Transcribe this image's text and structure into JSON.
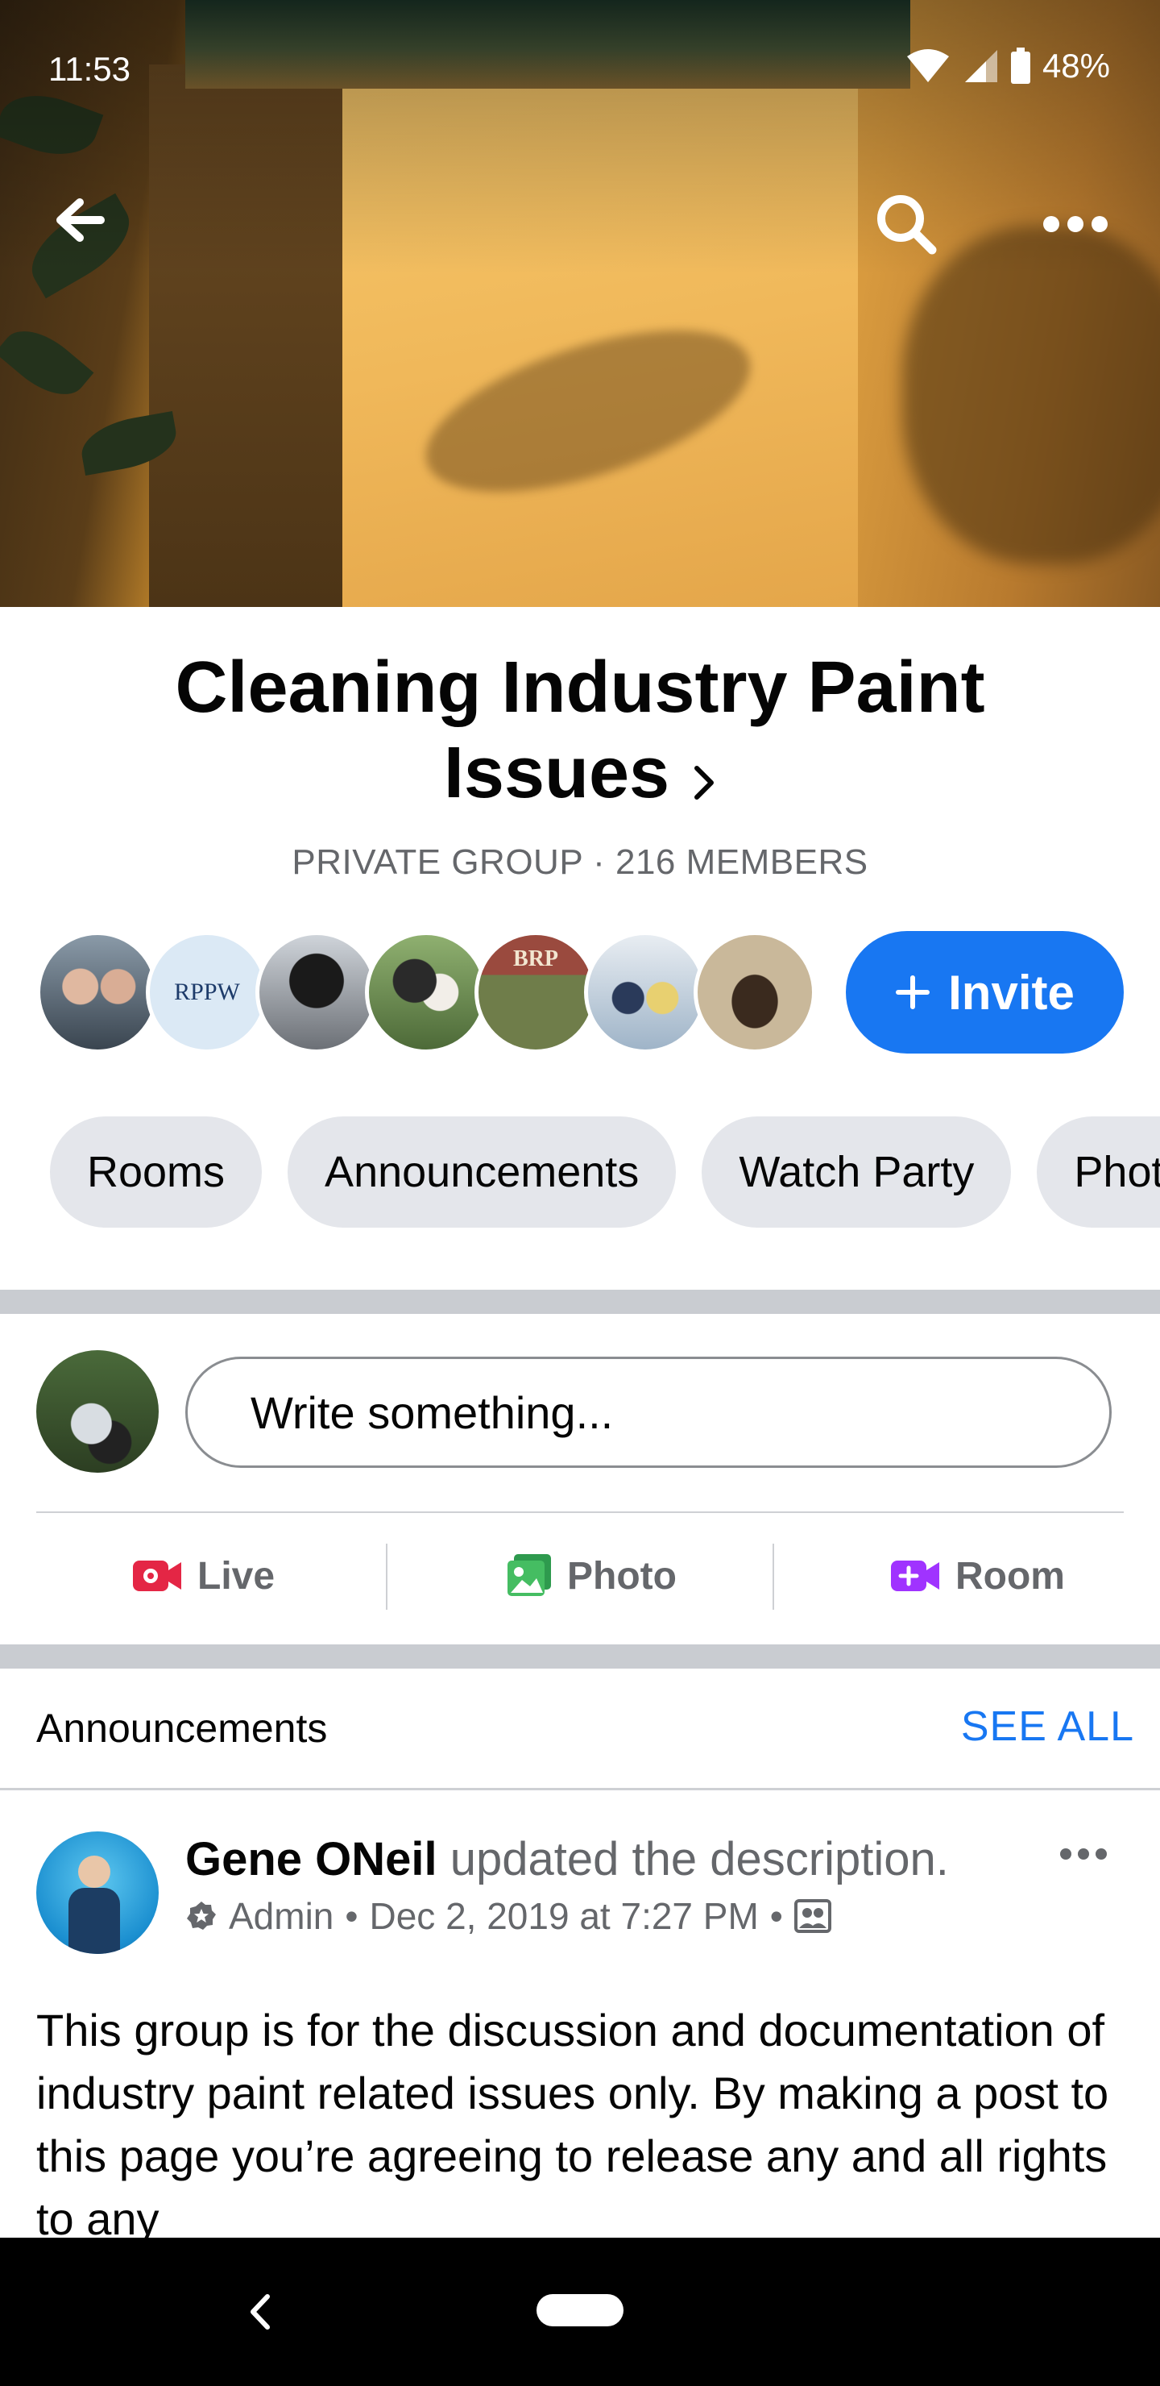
{
  "status_bar": {
    "time": "11:53",
    "battery": "48%"
  },
  "top_actions": {
    "back_icon": "back-arrow-icon",
    "search_icon": "search-icon",
    "more_icon": "more-horizontal-icon"
  },
  "group": {
    "title": "Cleaning Industry Paint Issues",
    "meta": "PRIVATE GROUP · 216 MEMBERS",
    "member_avatars": [
      {
        "name": "member-avatar-1",
        "color": "#5a6a78"
      },
      {
        "name": "member-avatar-2",
        "label": "RPPW",
        "color": "#dbe9f5"
      },
      {
        "name": "member-avatar-3",
        "color": "#3a3a3e"
      },
      {
        "name": "member-avatar-4",
        "color": "#6b8a55"
      },
      {
        "name": "member-avatar-5",
        "label": "BRP",
        "color": "#8c3a32"
      },
      {
        "name": "member-avatar-6",
        "color": "#9fb4c8"
      },
      {
        "name": "member-avatar-7",
        "color": "#c9b89a"
      }
    ],
    "invite_label": "Invite"
  },
  "chips": [
    "Rooms",
    "Announcements",
    "Watch Party",
    "Photos"
  ],
  "composer": {
    "placeholder": "Write something...",
    "live_label": "Live",
    "photo_label": "Photo",
    "room_label": "Room",
    "live_color": "#e42645",
    "photo_color": "#45bd62",
    "room_color": "#a033ff"
  },
  "announcements": {
    "header": "Announcements",
    "see_all": "SEE ALL",
    "post": {
      "author": "Gene ONeil",
      "action": "updated the description.",
      "role": "Admin",
      "date": "Dec 2, 2019 at 7:27 PM",
      "body": "This group is for the discussion and documentation of industry paint related issues only.  By making a post to this page you’re agreeing to release any and all rights to any"
    }
  },
  "colors": {
    "accent": "#1877f2",
    "chip_bg": "#e4e6eb",
    "secondary_text": "#65676b"
  }
}
